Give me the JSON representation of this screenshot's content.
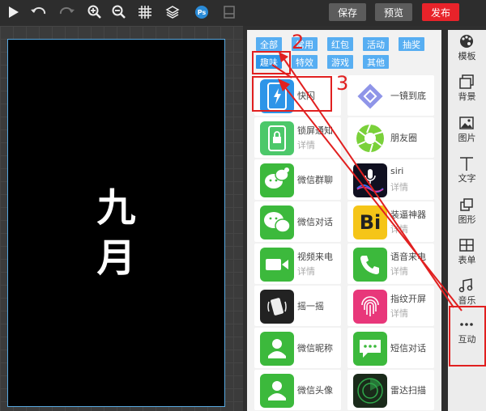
{
  "toolbar": {
    "icons": [
      "play-icon",
      "undo-icon",
      "redo-icon",
      "zoom-in-icon",
      "zoom-out-icon",
      "grid-icon",
      "layers-icon",
      "photoshop-icon",
      "disabled-icon"
    ],
    "ps_label": "Ps"
  },
  "header": {
    "save_label": "保存",
    "preview_label": "预览",
    "publish_label": "发布",
    "publish_color": "#e8232a"
  },
  "canvas": {
    "line1": "九",
    "line2": "月"
  },
  "categories": {
    "row1": [
      "全部",
      "常用",
      "红包",
      "活动",
      "抽奖"
    ],
    "row2": [
      "趣味",
      "特效",
      "游戏",
      "其他"
    ],
    "active": "趣味"
  },
  "components": [
    {
      "name": "快闪",
      "sub": ""
    },
    {
      "name": "一镜到底",
      "sub": ""
    },
    {
      "name": "锁屏通知",
      "sub": "详情"
    },
    {
      "name": "朋友圈",
      "sub": ""
    },
    {
      "name": "微信群聊",
      "sub": ""
    },
    {
      "name": "siri",
      "sub": "详情"
    },
    {
      "name": "微信对话",
      "sub": ""
    },
    {
      "name": "装逼神器",
      "sub": "详情"
    },
    {
      "name": "视频来电",
      "sub": "详情"
    },
    {
      "name": "语音来电",
      "sub": "详情"
    },
    {
      "name": "摇一摇",
      "sub": ""
    },
    {
      "name": "指纹开屏",
      "sub": "详情"
    },
    {
      "name": "微信昵称",
      "sub": ""
    },
    {
      "name": "短信对话",
      "sub": ""
    },
    {
      "name": "微信头像",
      "sub": ""
    },
    {
      "name": "雷达扫描",
      "sub": ""
    }
  ],
  "bi_label": "Bi",
  "sidebar": [
    {
      "label": "模板",
      "icon": "palette-icon"
    },
    {
      "label": "背景",
      "icon": "background-icon"
    },
    {
      "label": "图片",
      "icon": "image-icon"
    },
    {
      "label": "文字",
      "icon": "text-icon"
    },
    {
      "label": "图形",
      "icon": "shape-icon"
    },
    {
      "label": "表单",
      "icon": "form-icon"
    },
    {
      "label": "音乐",
      "icon": "music-icon"
    },
    {
      "label": "互动",
      "icon": "more-icon"
    }
  ],
  "annotations": {
    "step2": "2",
    "step3": "3",
    "color": "#e12020"
  },
  "colors": {
    "tag_blue": "#57aef2",
    "wechat_green": "#3cb93c"
  }
}
